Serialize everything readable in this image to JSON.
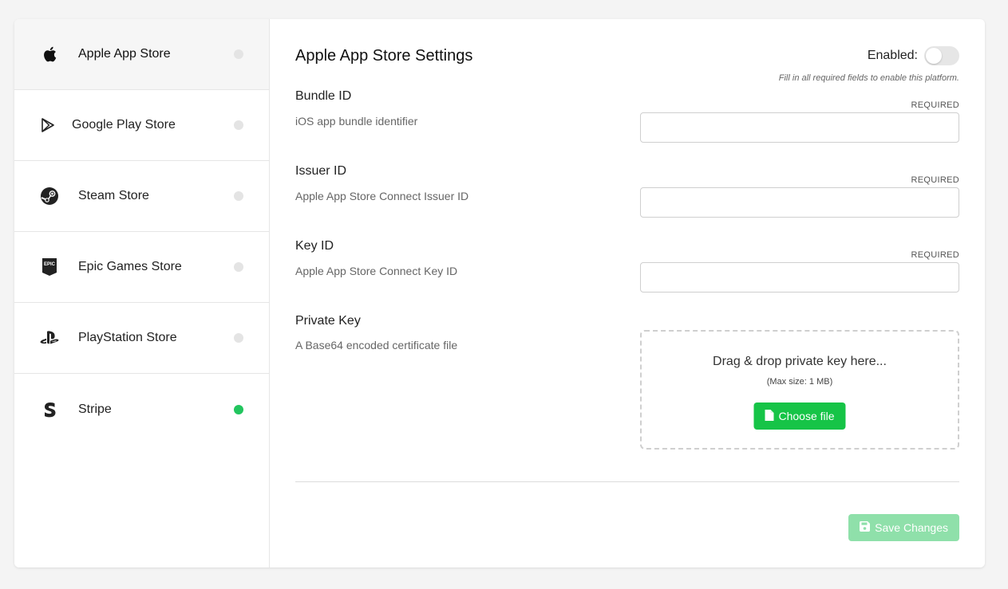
{
  "sidebar": {
    "items": [
      {
        "label": "Apple App Store",
        "icon": "apple-icon",
        "status": "inactive"
      },
      {
        "label": "Google Play Store",
        "icon": "google-play-icon",
        "status": "inactive"
      },
      {
        "label": "Steam Store",
        "icon": "steam-icon",
        "status": "inactive"
      },
      {
        "label": "Epic Games Store",
        "icon": "epic-games-icon",
        "status": "inactive"
      },
      {
        "label": "PlayStation Store",
        "icon": "playstation-icon",
        "status": "inactive"
      },
      {
        "label": "Stripe",
        "icon": "stripe-icon",
        "status": "active"
      }
    ],
    "active_index": 0,
    "epic_icon_text": "EPIC"
  },
  "settings": {
    "title": "Apple App Store Settings",
    "enabled_label": "Enabled:",
    "enabled": false,
    "hint": "Fill in all required fields to enable this platform."
  },
  "fields": [
    {
      "title": "Bundle ID",
      "description": "iOS app bundle identifier",
      "required_label": "REQUIRED",
      "value": ""
    },
    {
      "title": "Issuer ID",
      "description": "Apple App Store Connect Issuer ID",
      "required_label": "REQUIRED",
      "value": ""
    },
    {
      "title": "Key ID",
      "description": "Apple App Store Connect Key ID",
      "required_label": "REQUIRED",
      "value": ""
    }
  ],
  "private_key": {
    "title": "Private Key",
    "description": "A Base64 encoded certificate file",
    "dropzone_text": "Drag & drop private key here...",
    "max_size": "(Max size: 1 MB)",
    "choose_label": "Choose file"
  },
  "footer": {
    "save_label": "Save Changes",
    "save_enabled": false
  },
  "colors": {
    "accent": "#16c447",
    "accent_disabled": "#8fe0aa",
    "status_active": "#22c55e",
    "status_inactive": "#e4e4e4"
  }
}
